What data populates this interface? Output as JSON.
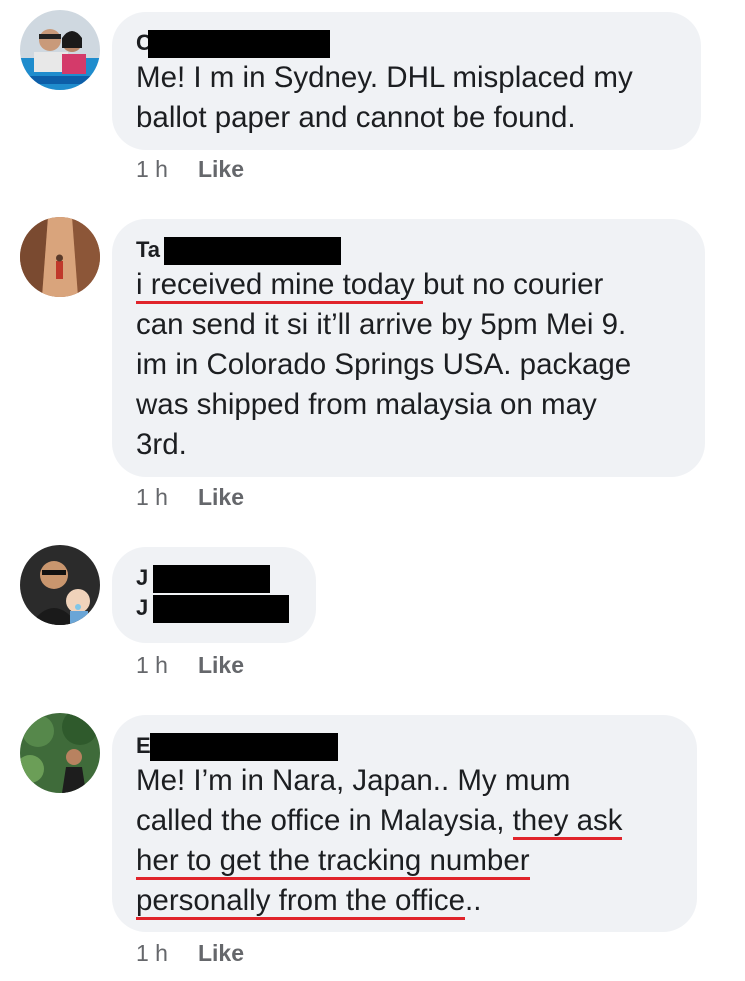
{
  "comments": [
    {
      "initial": "C",
      "lines": [
        "Me! I m in Sydney. DHL misplaced my",
        "ballot paper and cannot be found."
      ],
      "time": "1 h",
      "like": "Like"
    },
    {
      "initial": "Ta",
      "line1_underlined": "i received mine today ",
      "line1_rest": "but no courier",
      "lines": [
        "can send it si it’ll arrive by 5pm Mei 9.",
        "im in Colorado Springs USA. package",
        "was shipped from malaysia on may",
        "3rd."
      ],
      "time": "1 h",
      "like": "Like"
    },
    {
      "initial": "J",
      "line2_initial": "J",
      "time": "1 h",
      "like": "Like"
    },
    {
      "initial": "E",
      "line1": "Me! I’m in Nara, Japan.. My mum",
      "line2_plain": "called the office in Malaysia, ",
      "line2_underlined": "they ask",
      "line3_underlined": "her to get the tracking number",
      "line4_underlined": "personally from the office",
      "line4_rest": "..",
      "time": "1 h",
      "like": "Like"
    }
  ],
  "colors": {
    "bubble": "#f0f2f5",
    "underline": "#e0242b",
    "meta": "#65676b"
  }
}
